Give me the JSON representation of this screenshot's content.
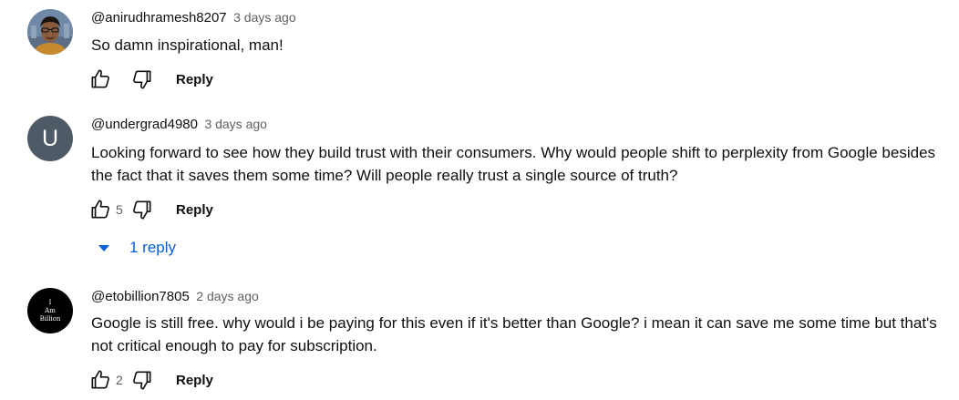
{
  "comments": [
    {
      "author": "@anirudhramesh8207",
      "time": "3 days ago",
      "text": "So damn inspirational, man!",
      "likes": "",
      "reply_label": "Reply",
      "avatar_type": "photo"
    },
    {
      "author": "@undergrad4980",
      "time": "3 days ago",
      "text": "Looking forward to see how they build trust with their consumers. Why would people shift to perplexity from Google besides the fact that it saves them some time? Will people really trust a single source of truth?",
      "likes": "5",
      "reply_label": "Reply",
      "avatar_letter": "U",
      "avatar_color": "#4e5b66",
      "replies_label": "1 reply"
    },
    {
      "author": "@etobillion7805",
      "time": "2 days ago",
      "text": "Google is still free. why would i be paying for this even if it's better than Google?  i mean it can save me some time but that's not critical enough to pay for subscription.",
      "likes": "2",
      "reply_label": "Reply",
      "avatar_lines": [
        "I",
        "Am",
        "Billion"
      ]
    }
  ],
  "colors": {
    "link_blue": "#065fd4",
    "meta_gray": "#606060",
    "text": "#0f0f0f"
  },
  "icons": [
    "thumbs-up-icon",
    "thumbs-down-icon",
    "caret-down-icon"
  ]
}
